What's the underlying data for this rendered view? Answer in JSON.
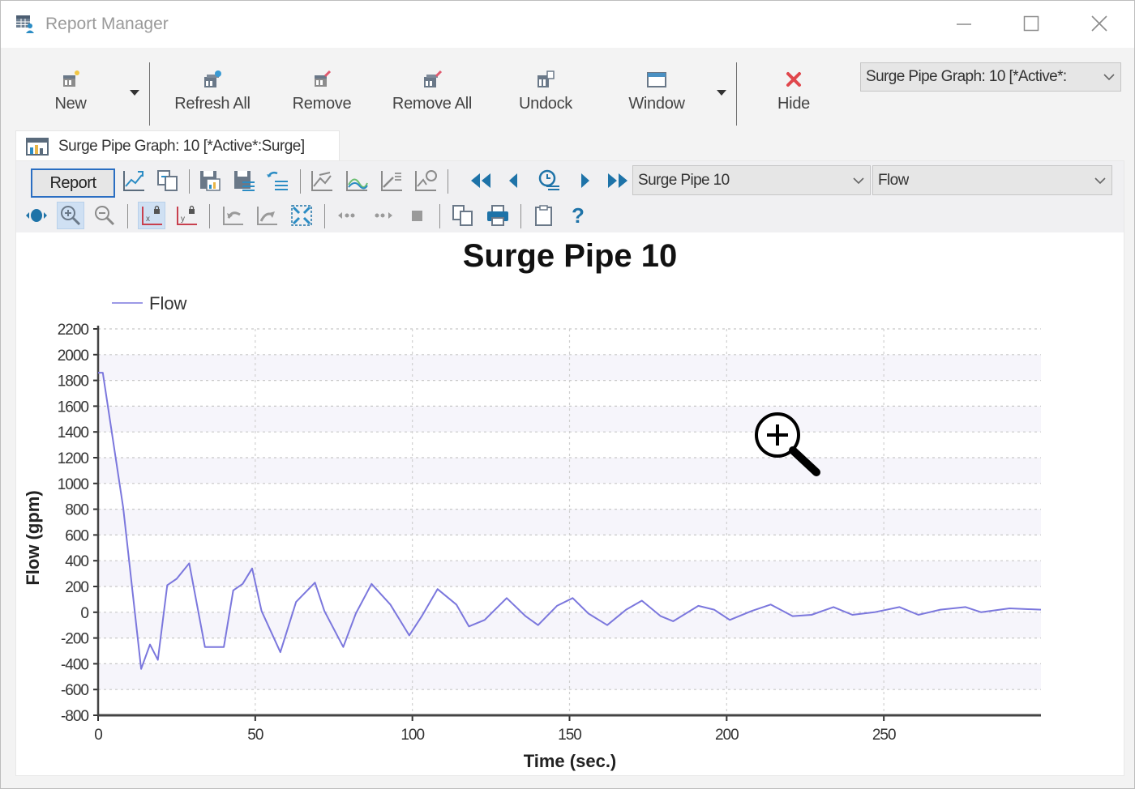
{
  "window": {
    "title": "Report Manager",
    "controls": [
      "minimize",
      "maximize",
      "close"
    ]
  },
  "ribbon": {
    "buttons": [
      {
        "label": "New",
        "icon": "new-report-icon",
        "has_dropdown": true
      },
      {
        "label": "Refresh All",
        "icon": "refresh-all-icon"
      },
      {
        "label": "Remove",
        "icon": "remove-icon"
      },
      {
        "label": "Remove All",
        "icon": "remove-all-icon"
      },
      {
        "label": "Undock",
        "icon": "undock-icon"
      },
      {
        "label": "Window",
        "icon": "window-icon",
        "has_dropdown": true
      },
      {
        "label": "Hide",
        "icon": "hide-x-icon"
      }
    ],
    "report_selector": {
      "value": "Surge Pipe Graph: 10 [*Active*:Surge]",
      "display": "Surge Pipe Graph: 10 [*Active*:"
    }
  },
  "document_tab": {
    "label": "Surge Pipe Graph: 10 [*Active*:Surge]"
  },
  "graph_toolbar": {
    "report_button": "Report",
    "element_selector": {
      "value": "Surge Pipe 10"
    },
    "field_selector": {
      "value": "Flow"
    },
    "help_label": "?"
  },
  "colors": {
    "series": "#7b77dd",
    "accent_blue": "#1e73a8",
    "hide_red": "#e0474c",
    "report_border": "#2a6ec2"
  },
  "chart_data": {
    "type": "line",
    "title": "Surge Pipe 10",
    "xlabel": "Time (sec.)",
    "ylabel": "Flow (gpm)",
    "xlim": [
      0,
      300
    ],
    "ylim": [
      -800,
      2200
    ],
    "xticks": [
      0,
      50,
      100,
      150,
      200,
      250
    ],
    "yticks": [
      2200,
      2000,
      1800,
      1600,
      1400,
      1200,
      1000,
      800,
      600,
      400,
      200,
      0,
      -200,
      -400,
      -600,
      -800
    ],
    "grid": true,
    "legend": {
      "position": "top-left",
      "entries": [
        "Flow"
      ]
    },
    "series": [
      {
        "name": "Flow",
        "x": [
          0,
          1.5,
          8,
          13.7,
          16.5,
          19,
          22,
          25,
          29,
          34,
          40,
          43,
          46,
          49,
          52,
          58,
          63,
          69,
          72,
          78,
          82,
          87,
          93,
          99,
          103,
          108,
          114,
          118,
          123,
          130,
          136,
          140,
          146,
          151,
          156,
          162,
          168,
          173,
          179,
          183,
          191,
          196,
          201,
          208,
          214,
          221,
          227,
          234,
          240,
          247,
          255,
          261,
          268,
          276,
          281,
          290,
          300
        ],
        "y": [
          1860,
          1860,
          810,
          -440,
          -250,
          -370,
          210,
          260,
          380,
          -270,
          -270,
          170,
          220,
          340,
          10,
          -310,
          80,
          230,
          10,
          -270,
          -10,
          220,
          60,
          -180,
          -30,
          180,
          60,
          -110,
          -60,
          110,
          -30,
          -100,
          50,
          110,
          -10,
          -100,
          20,
          90,
          -30,
          -70,
          50,
          20,
          -60,
          10,
          60,
          -30,
          -20,
          40,
          -20,
          0,
          40,
          -20,
          20,
          40,
          0,
          30,
          20
        ]
      }
    ]
  }
}
